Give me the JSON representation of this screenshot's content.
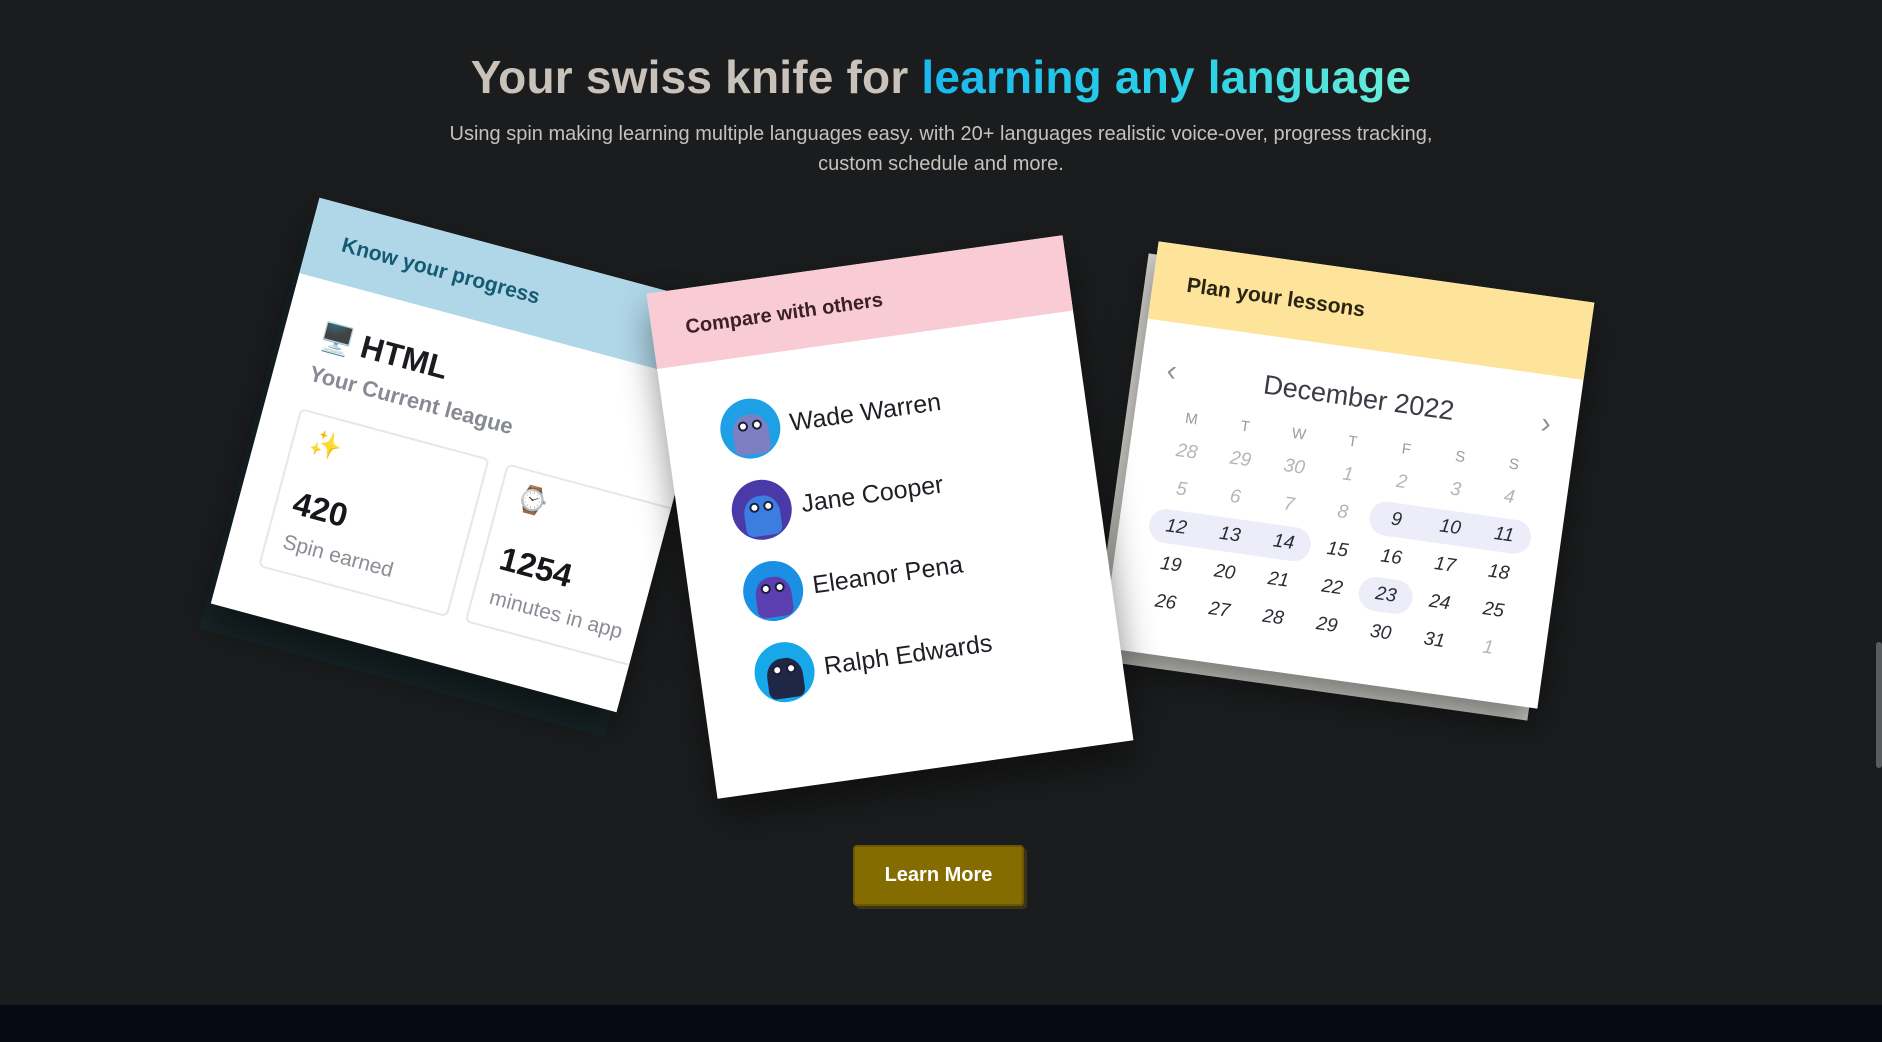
{
  "hero": {
    "title_prefix": "Your swiss knife for ",
    "title_accent": "learning any language",
    "subtitle_line1": "Using spin making learning multiple languages easy. with 20+ languages realistic voice-over, progress tracking,",
    "subtitle_line2": "custom schedule and more."
  },
  "progress_card": {
    "header": "Know your progress",
    "league_icon": "🖥️",
    "league_name": "HTML",
    "league_label": "Your Current league",
    "stats": [
      {
        "icon": "✨",
        "icon_name": "sparkles-icon",
        "value": "420",
        "label": "Spin earned"
      },
      {
        "icon": "⌚",
        "icon_name": "watch-icon",
        "value": "1254",
        "label": "minutes in app"
      }
    ]
  },
  "compare_card": {
    "header": "Compare with others",
    "people": [
      {
        "name": "Wade Warren",
        "avatar_bg": "#1ea0e6",
        "face": "#7c80c2"
      },
      {
        "name": "Jane Cooper",
        "avatar_bg": "#4a3aa8",
        "face": "#3b7ee0"
      },
      {
        "name": "Eleanor Pena",
        "avatar_bg": "#1b8fe3",
        "face": "#5b3fb0"
      },
      {
        "name": "Ralph Edwards",
        "avatar_bg": "#16a8e8",
        "face": "#1f2747"
      }
    ]
  },
  "plan_card": {
    "header": "Plan your lessons",
    "month": "December 2022",
    "prev_icon": "‹",
    "next_icon": "›",
    "weekdays": [
      "M",
      "T",
      "W",
      "T",
      "F",
      "S",
      "S"
    ],
    "days": [
      {
        "d": "28",
        "m": true
      },
      {
        "d": "29",
        "m": true
      },
      {
        "d": "30",
        "m": true
      },
      {
        "d": "1",
        "m": true
      },
      {
        "d": "2",
        "m": true
      },
      {
        "d": "3",
        "m": true
      },
      {
        "d": "4",
        "m": true
      },
      {
        "d": "5",
        "m": true
      },
      {
        "d": "6",
        "m": true
      },
      {
        "d": "7",
        "m": true
      },
      {
        "d": "8",
        "m": true
      },
      {
        "d": "9",
        "h": "start"
      },
      {
        "d": "10",
        "h": "mid"
      },
      {
        "d": "11",
        "h": "end"
      },
      {
        "d": "12",
        "h": "start"
      },
      {
        "d": "13",
        "h": "mid"
      },
      {
        "d": "14",
        "h": "end"
      },
      {
        "d": "15"
      },
      {
        "d": "16"
      },
      {
        "d": "17"
      },
      {
        "d": "18"
      },
      {
        "d": "19"
      },
      {
        "d": "20"
      },
      {
        "d": "21"
      },
      {
        "d": "22"
      },
      {
        "d": "23",
        "h": "single"
      },
      {
        "d": "24"
      },
      {
        "d": "25"
      },
      {
        "d": "26"
      },
      {
        "d": "27"
      },
      {
        "d": "28"
      },
      {
        "d": "29"
      },
      {
        "d": "30"
      },
      {
        "d": "31"
      },
      {
        "d": "1",
        "m": true
      }
    ]
  },
  "cta": {
    "label": "Learn More"
  },
  "colors": {
    "background": "#1b1c1d",
    "accent_gradient_start": "#19b8ef",
    "accent_gradient_end": "#6ef0d9",
    "progress_header": "#b0d7e8",
    "compare_header": "#f9cbd5",
    "plan_header": "#fde49a",
    "button": "#846c00"
  }
}
